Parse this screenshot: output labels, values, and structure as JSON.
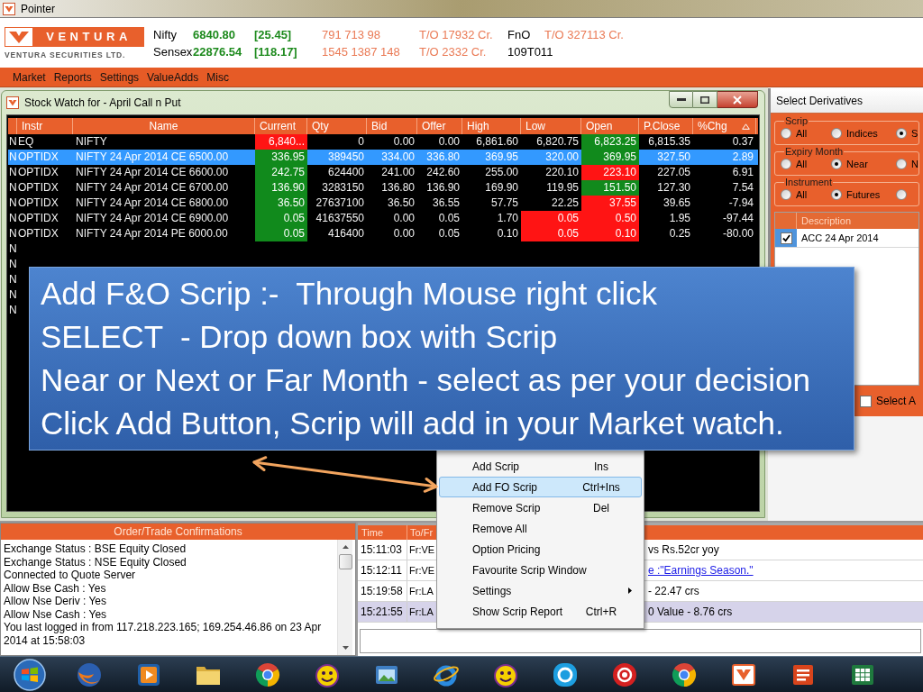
{
  "app": {
    "title": "Pointer"
  },
  "logo": {
    "brand": "VENTURA",
    "tagline": "VENTURA SECURITIES LTD."
  },
  "ticker": {
    "rows": [
      {
        "name": "Nifty",
        "value": "6840.80",
        "change": "[25.45]",
        "volume": "791 713 98",
        "turnover": "T/O 17932 Cr.",
        "segment": "FnO",
        "segment_turnover": "T/O 327113 Cr."
      },
      {
        "name": "Sensex",
        "value": "22876.54",
        "change": "[118.17]",
        "volume": "1545 1387 148",
        "turnover": "T/O 2332 Cr.",
        "code": "109T011"
      }
    ]
  },
  "menu": [
    "Market",
    "Reports",
    "Settings",
    "ValueAdds",
    "Misc"
  ],
  "stock_watch": {
    "title": "Stock Watch for - April Call n Put",
    "columns": [
      {
        "label": "Instr",
        "sorted": false
      },
      {
        "label": "Name",
        "sorted": false
      },
      {
        "label": "Current",
        "sorted": false
      },
      {
        "label": "Qty",
        "sorted": false
      },
      {
        "label": "Bid",
        "sorted": false
      },
      {
        "label": "Offer",
        "sorted": false
      },
      {
        "label": "High",
        "sorted": false
      },
      {
        "label": "Low",
        "sorted": false
      },
      {
        "label": "Open",
        "sorted": false
      },
      {
        "label": "P.Close",
        "sorted": false
      },
      {
        "label": "%Chg",
        "sorted": true
      }
    ],
    "rows": [
      {
        "exchange": "N",
        "instr": "EQ",
        "name": "NIFTY",
        "selected": false,
        "cells": [
          {
            "text": "6,840...",
            "color": "#ff1414"
          },
          {
            "text": "0"
          },
          {
            "text": "0.00"
          },
          {
            "text": "0.00"
          },
          {
            "text": "6,861.60"
          },
          {
            "text": "6,820.75"
          },
          {
            "text": "6,823.25",
            "color": "#118a1c"
          },
          {
            "text": "6,815.35"
          },
          {
            "text": "0.37"
          }
        ]
      },
      {
        "exchange": "N",
        "instr": "OPTIDX",
        "name": "NIFTY 24 Apr 2014 CE 6500.00",
        "selected": true,
        "cells": [
          {
            "text": "336.95",
            "color": "#118a1c"
          },
          {
            "text": "389450"
          },
          {
            "text": "334.00"
          },
          {
            "text": "336.80"
          },
          {
            "text": "369.95"
          },
          {
            "text": "320.00"
          },
          {
            "text": "369.95",
            "color": "#118a1c"
          },
          {
            "text": "327.50"
          },
          {
            "text": "2.89"
          }
        ]
      },
      {
        "exchange": "N",
        "instr": "OPTIDX",
        "name": "NIFTY 24 Apr 2014 CE 6600.00",
        "selected": false,
        "cells": [
          {
            "text": "242.75",
            "color": "#118a1c"
          },
          {
            "text": "624400"
          },
          {
            "text": "241.00"
          },
          {
            "text": "242.60"
          },
          {
            "text": "255.00"
          },
          {
            "text": "220.10"
          },
          {
            "text": "223.10",
            "color": "#ff1414"
          },
          {
            "text": "227.05"
          },
          {
            "text": "6.91"
          }
        ]
      },
      {
        "exchange": "N",
        "instr": "OPTIDX",
        "name": "NIFTY 24 Apr 2014 CE 6700.00",
        "selected": false,
        "cells": [
          {
            "text": "136.90",
            "color": "#118a1c"
          },
          {
            "text": "3283150"
          },
          {
            "text": "136.80"
          },
          {
            "text": "136.90"
          },
          {
            "text": "169.90"
          },
          {
            "text": "119.95"
          },
          {
            "text": "151.50",
            "color": "#118a1c"
          },
          {
            "text": "127.30"
          },
          {
            "text": "7.54"
          }
        ]
      },
      {
        "exchange": "N",
        "instr": "OPTIDX",
        "name": "NIFTY 24 Apr 2014 CE 6800.00",
        "selected": false,
        "cells": [
          {
            "text": "36.50",
            "color": "#118a1c"
          },
          {
            "text": "27637100"
          },
          {
            "text": "36.50"
          },
          {
            "text": "36.55"
          },
          {
            "text": "57.75"
          },
          {
            "text": "22.25"
          },
          {
            "text": "37.55",
            "color": "#ff1414"
          },
          {
            "text": "39.65"
          },
          {
            "text": "-7.94"
          }
        ]
      },
      {
        "exchange": "N",
        "instr": "OPTIDX",
        "name": "NIFTY 24 Apr 2014 CE 6900.00",
        "selected": false,
        "cells": [
          {
            "text": "0.05",
            "color": "#118a1c"
          },
          {
            "text": "41637550"
          },
          {
            "text": "0.00"
          },
          {
            "text": "0.05"
          },
          {
            "text": "1.70"
          },
          {
            "text": "0.05",
            "color": "#ff1414"
          },
          {
            "text": "0.50",
            "color": "#ff1414"
          },
          {
            "text": "1.95"
          },
          {
            "text": "-97.44"
          }
        ]
      },
      {
        "exchange": "N",
        "instr": "OPTIDX",
        "name": "NIFTY 24 Apr 2014 PE 6000.00",
        "selected": false,
        "cells": [
          {
            "text": "0.05",
            "color": "#118a1c"
          },
          {
            "text": "416400"
          },
          {
            "text": "0.00"
          },
          {
            "text": "0.05"
          },
          {
            "text": "0.10"
          },
          {
            "text": "0.05",
            "color": "#ff1414"
          },
          {
            "text": "0.10",
            "color": "#ff1414"
          },
          {
            "text": "0.25"
          },
          {
            "text": "-80.00"
          }
        ]
      },
      {
        "exchange": "N",
        "selected": false
      },
      {
        "exchange": "N",
        "selected": false
      },
      {
        "exchange": "N",
        "selected": false
      },
      {
        "exchange": "N",
        "selected": false
      },
      {
        "exchange": "N",
        "selected": false
      }
    ]
  },
  "derivatives": {
    "title": "Select Derivatives",
    "groups": [
      {
        "legend": "Scrip",
        "options": [
          {
            "label": "All",
            "selected": false
          },
          {
            "label": "Indices",
            "selected": false
          },
          {
            "label": "S",
            "selected": true
          }
        ]
      },
      {
        "legend": "Expiry Month",
        "options": [
          {
            "label": "All",
            "selected": false
          },
          {
            "label": "Near",
            "selected": true
          },
          {
            "label": "N",
            "selected": false
          }
        ]
      },
      {
        "legend": "Instrument",
        "options": [
          {
            "label": "All",
            "selected": false
          },
          {
            "label": "Futures",
            "selected": true
          },
          {
            "selected": false
          }
        ]
      }
    ],
    "list": {
      "column": "Description",
      "rows": [
        {
          "label": "ACC 24 Apr 2014",
          "checked": true
        }
      ]
    },
    "select_all": {
      "label": "Select A",
      "checked": false
    }
  },
  "callout": {
    "lines": [
      "Add F&O Scrip :-  Through Mouse right click",
      "SELECT  - Drop down box with Scrip",
      "Near or Next or Far Month - select as per your decision",
      "Click Add Button, Scrip will add in your Market watch."
    ]
  },
  "context_menu": {
    "items": [
      {
        "label": "Add Scrip",
        "shortcut": "Ins",
        "selected": false,
        "submenu": false
      },
      {
        "label": "Add FO Scrip",
        "shortcut": "Ctrl+Ins",
        "selected": true,
        "submenu": false
      },
      {
        "label": "Remove Scrip",
        "shortcut": "Del",
        "selected": false,
        "submenu": false
      },
      {
        "label": "Remove All",
        "selected": false,
        "submenu": false
      },
      {
        "label": "Option Pricing",
        "selected": false,
        "submenu": false
      },
      {
        "label": "Favourite Scrip Window",
        "selected": false,
        "submenu": false
      },
      {
        "label": "Settings",
        "selected": false,
        "submenu": true
      },
      {
        "label": "Show Scrip Report",
        "shortcut": "Ctrl+R",
        "selected": false,
        "submenu": false
      }
    ]
  },
  "confirmations": {
    "title": "Order/Trade Confirmations",
    "messages": [
      "Exchange Status : BSE Equity Closed",
      "Exchange Status : NSE Equity Closed",
      "Connected to Quote Server",
      "Allow Bse Cash : Yes",
      "Allow Nse Deriv : Yes",
      "Allow Nse Cash : Yes",
      "You last logged in from 117.218.223.165; 169.254.46.86 on 23 Apr 2014 at 15:58:03"
    ]
  },
  "messages": {
    "columns": [
      "Time",
      "To/Fr"
    ],
    "rows": [
      {
        "time": "15:11:03",
        "from": "Fr:VE",
        "kind": "plain",
        "text": "vs Rs.52cr yoy",
        "selected": false
      },
      {
        "time": "15:12:11",
        "from": "Fr:VE",
        "kind": "link",
        "text": "e :\"Earnings Season.\"",
        "selected": false
      },
      {
        "time": "15:19:58",
        "from": "Fr:LA",
        "kind": "plain",
        "text": "- 22.47 crs",
        "selected": false
      },
      {
        "time": "15:21:55",
        "from": "Fr:LA",
        "kind": "plain",
        "text": "0 Value - 8.76 crs",
        "selected": true
      }
    ]
  }
}
